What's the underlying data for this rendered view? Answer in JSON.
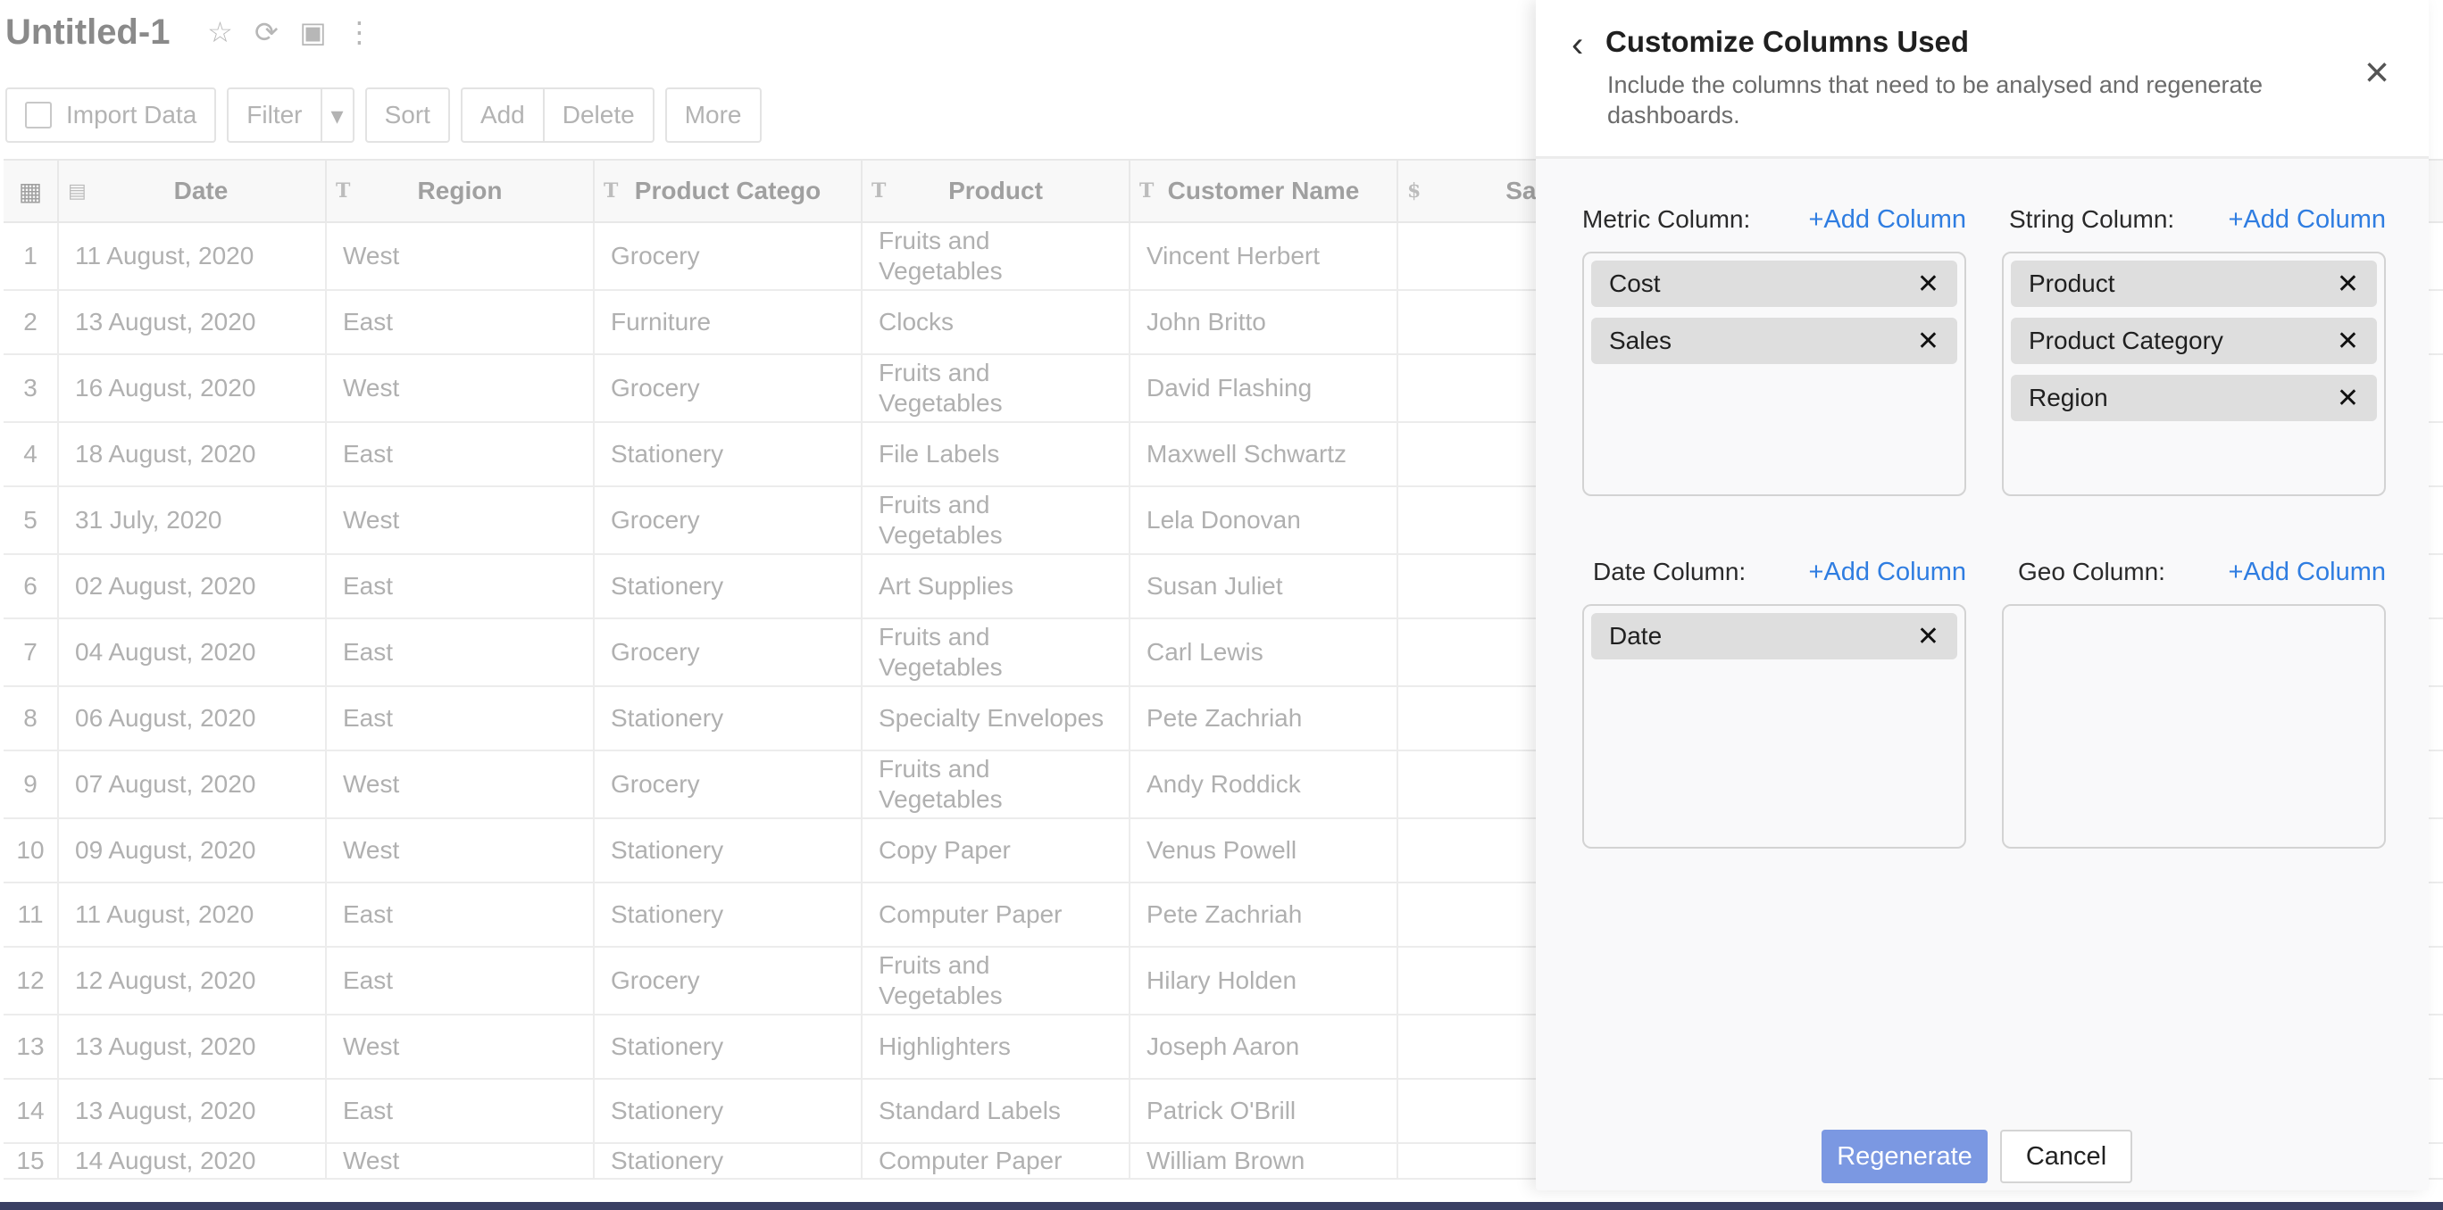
{
  "sheet": {
    "title": "Untitled-1",
    "toolbar": {
      "import_label": "Import Data",
      "filter_label": "Filter",
      "sort_label": "Sort",
      "add_label": "Add",
      "delete_label": "Delete",
      "more_label": "More"
    },
    "columns": [
      "Date",
      "Region",
      "Product Catego",
      "Product",
      "Customer Name",
      "Sale"
    ],
    "rows": [
      {
        "n": "1",
        "date": "11 August, 2020",
        "region": "West",
        "category": "Grocery",
        "product": "Fruits and Vegetables",
        "customer": "Vincent Herbert"
      },
      {
        "n": "2",
        "date": "13 August, 2020",
        "region": "East",
        "category": "Furniture",
        "product": "Clocks",
        "customer": "John Britto"
      },
      {
        "n": "3",
        "date": "16 August, 2020",
        "region": "West",
        "category": "Grocery",
        "product": "Fruits and Vegetables",
        "customer": "David Flashing"
      },
      {
        "n": "4",
        "date": "18 August, 2020",
        "region": "East",
        "category": "Stationery",
        "product": "File Labels",
        "customer": "Maxwell Schwartz"
      },
      {
        "n": "5",
        "date": "31 July, 2020",
        "region": "West",
        "category": "Grocery",
        "product": "Fruits and Vegetables",
        "customer": "Lela Donovan"
      },
      {
        "n": "6",
        "date": "02 August, 2020",
        "region": "East",
        "category": "Stationery",
        "product": "Art Supplies",
        "customer": "Susan Juliet"
      },
      {
        "n": "7",
        "date": "04 August, 2020",
        "region": "East",
        "category": "Grocery",
        "product": "Fruits and Vegetables",
        "customer": "Carl Lewis"
      },
      {
        "n": "8",
        "date": "06 August, 2020",
        "region": "East",
        "category": "Stationery",
        "product": "Specialty Envelopes",
        "customer": "Pete Zachriah"
      },
      {
        "n": "9",
        "date": "07 August, 2020",
        "region": "West",
        "category": "Grocery",
        "product": "Fruits and Vegetables",
        "customer": "Andy Roddick"
      },
      {
        "n": "10",
        "date": "09 August, 2020",
        "region": "West",
        "category": "Stationery",
        "product": "Copy Paper",
        "customer": "Venus Powell"
      },
      {
        "n": "11",
        "date": "11 August, 2020",
        "region": "East",
        "category": "Stationery",
        "product": "Computer Paper",
        "customer": "Pete Zachriah"
      },
      {
        "n": "12",
        "date": "12 August, 2020",
        "region": "East",
        "category": "Grocery",
        "product": "Fruits and Vegetables",
        "customer": "Hilary Holden"
      },
      {
        "n": "13",
        "date": "13 August, 2020",
        "region": "West",
        "category": "Stationery",
        "product": "Highlighters",
        "customer": "Joseph Aaron"
      },
      {
        "n": "14",
        "date": "13 August, 2020",
        "region": "East",
        "category": "Stationery",
        "product": "Standard Labels",
        "customer": "Patrick O'Brill"
      },
      {
        "n": "15",
        "date": "14 August, 2020",
        "region": "West",
        "category": "Stationery",
        "product": "Computer Paper",
        "customer": "William Brown"
      }
    ]
  },
  "panel": {
    "title": "Customize Columns Used",
    "subtitle": "Include the columns that need to be analysed and regenerate dashboards.",
    "add_label": "+Add Column",
    "sections": {
      "metric": {
        "label": "Metric Column:",
        "chips": [
          "Cost",
          "Sales"
        ]
      },
      "string": {
        "label": "String Column:",
        "chips": [
          "Product",
          "Product Category",
          "Region"
        ]
      },
      "date": {
        "label": "Date Column:",
        "chips": [
          "Date"
        ]
      },
      "geo": {
        "label": "Geo Column:",
        "chips": []
      }
    },
    "regenerate_label": "Regenerate",
    "cancel_label": "Cancel"
  }
}
